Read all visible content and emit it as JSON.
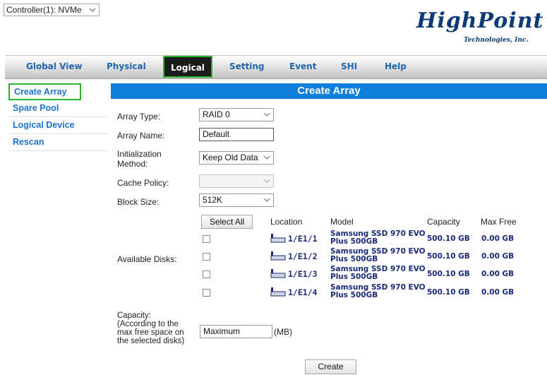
{
  "controller": {
    "selected": "Controller(1): NVMe"
  },
  "logo": {
    "main": "HighPoint",
    "sub": "Technologies, Inc."
  },
  "nav": {
    "tabs": [
      "Global View",
      "Physical",
      "Logical",
      "Setting",
      "Event",
      "SHI",
      "Help"
    ],
    "active": "Logical"
  },
  "sidebar": {
    "items": [
      "Create Array",
      "Spare Pool",
      "Logical Device",
      "Rescan"
    ],
    "active": "Create Array"
  },
  "header": {
    "title": "Create Array"
  },
  "form": {
    "array_type_label": "Array Type:",
    "array_type_value": "RAID 0",
    "array_name_label": "Array Name:",
    "array_name_value": "Default",
    "init_label_1": "Initialization",
    "init_label_2": "Method:",
    "init_value": "Keep Old Data",
    "cache_label": "Cache Policy:",
    "cache_value": "",
    "block_label": "Block Size:",
    "block_value": "512K",
    "available_label": "Available Disks:",
    "select_all": "Select All",
    "col_location": "Location",
    "col_model": "Model",
    "col_capacity": "Capacity",
    "col_maxfree": "Max Free",
    "disks": [
      {
        "location": "1/E1/1",
        "model_1": "Samsung SSD 970 EVO",
        "model_2": "Plus 500GB",
        "capacity": "500.10 GB",
        "max_free": "0.00 GB",
        "checked": false
      },
      {
        "location": "1/E1/2",
        "model_1": "Samsung SSD 970 EVO",
        "model_2": "Plus 500GB",
        "capacity": "500.10 GB",
        "max_free": "0.00 GB",
        "checked": false
      },
      {
        "location": "1/E1/3",
        "model_1": "Samsung SSD 970 EVO",
        "model_2": "Plus 500GB",
        "capacity": "500.10 GB",
        "max_free": "0.00 GB",
        "checked": false
      },
      {
        "location": "1/E1/4",
        "model_1": "Samsung SSD 970 EVO",
        "model_2": "Plus 500GB",
        "capacity": "500.10 GB",
        "max_free": "0.00 GB",
        "checked": false
      }
    ],
    "capacity_label_1": "Capacity:",
    "capacity_label_2": "(According to the",
    "capacity_label_3": "max free space on",
    "capacity_label_4": "the selected disks)",
    "capacity_value": "Maximum",
    "capacity_unit": "(MB)",
    "create_button": "Create"
  },
  "colors": {
    "header_blue": "#0f7fdc",
    "link_blue": "#1a73d0",
    "highlight_green": "#2bb32b",
    "active_tab": "#1b1b1b"
  }
}
